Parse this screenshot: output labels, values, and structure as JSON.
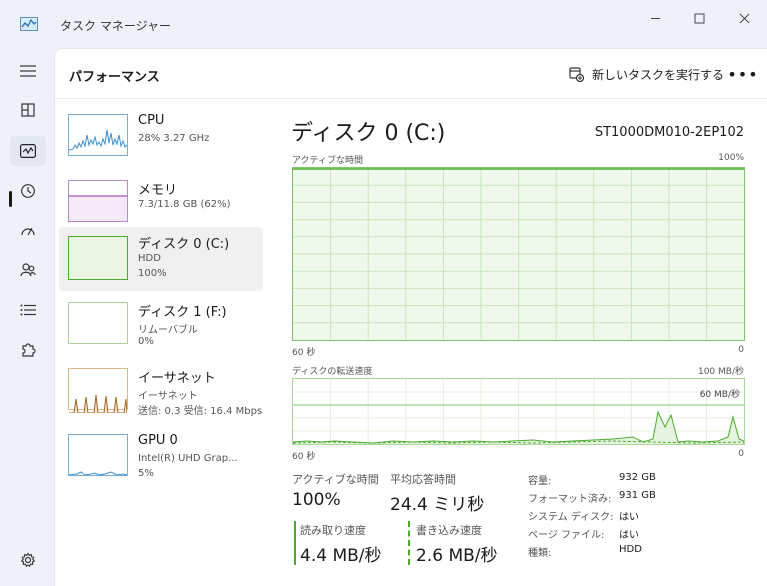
{
  "window": {
    "title": "タスク マネージャー"
  },
  "header": {
    "page_title": "パフォーマンス",
    "new_task_label": "新しいタスクを実行する",
    "more_label": "•••"
  },
  "devices": [
    {
      "name": "CPU",
      "line1": "28%  3.27 GHz",
      "line2": ""
    },
    {
      "name": "メモリ",
      "line1": "7.3/11.8 GB (62%)",
      "line2": ""
    },
    {
      "name": "ディスク 0 (C:)",
      "line1": "HDD",
      "line2": "100%"
    },
    {
      "name": "ディスク 1 (F:)",
      "line1": "リムーバブル",
      "line2": "0%"
    },
    {
      "name": "イーサネット",
      "line1": "イーサネット",
      "line2": "送信: 0.3  受信: 16.4 Mbps"
    },
    {
      "name": "GPU 0",
      "line1": "Intel(R) UHD Grap...",
      "line2": "5%"
    }
  ],
  "detail": {
    "title": "ディスク 0 (C:)",
    "model": "ST1000DM010-2EP102",
    "active_time_graph": {
      "label": "アクティブな時間",
      "max_label": "100%",
      "time_label": "60 秒",
      "min_label": "0"
    },
    "transfer_graph": {
      "label": "ディスクの転送速度",
      "max_label": "100 MB/秒",
      "ref_label": "60 MB/秒",
      "time_label": "60 秒",
      "min_label": "0"
    },
    "stats": {
      "active_time_label": "アクティブな時間",
      "active_time_value": "100%",
      "avg_response_label": "平均応答時間",
      "avg_response_value": "24.4 ミリ秒",
      "read_speed_label": "読み取り速度",
      "read_speed_value": "4.4 MB/秒",
      "write_speed_label": "書き込み速度",
      "write_speed_value": "2.6 MB/秒"
    },
    "properties": [
      {
        "label": "容量:",
        "value": "932 GB"
      },
      {
        "label": "フォーマット済み:",
        "value": "931 GB"
      },
      {
        "label": "システム ディスク:",
        "value": "はい"
      },
      {
        "label": "ページ ファイル:",
        "value": "はい"
      },
      {
        "label": "種類:",
        "value": "HDD"
      }
    ]
  },
  "colors": {
    "cpu": "#3a8fd0",
    "memory": "#8b2fa8",
    "disk": "#4caa2e",
    "ethernet": "#a8641a",
    "gpu": "#3a8fd0"
  }
}
